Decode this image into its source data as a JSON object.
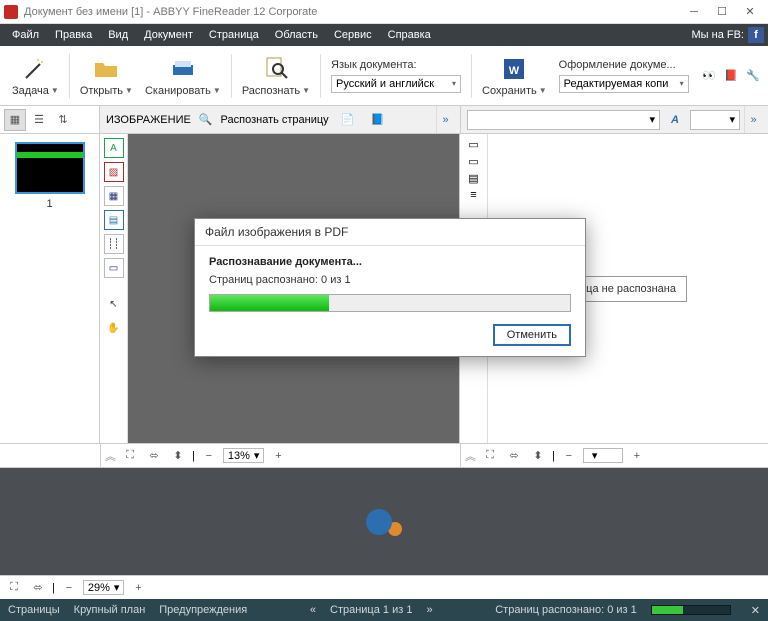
{
  "title": "Документ без имени [1] - ABBYY FineReader 12 Corporate",
  "menu": [
    "Файл",
    "Правка",
    "Вид",
    "Документ",
    "Страница",
    "Область",
    "Сервис",
    "Справка"
  ],
  "menu_right": "Мы на FB:",
  "ribbon": {
    "task": "Задача",
    "open": "Открыть",
    "scan": "Сканировать",
    "read": "Распознать",
    "lang_label": "Язык документа:",
    "lang_value": "Русский и английск",
    "save": "Сохранить",
    "format_label": "Оформление докуме...",
    "format_value": "Редактируемая копи"
  },
  "secbar": {
    "image_label": "ИЗОБРАЖЕНИЕ",
    "read_page": "Распознать страницу"
  },
  "thumb": {
    "page_number": "1"
  },
  "textview_msg": "ица не распознана",
  "zoom": {
    "img": "13%",
    "bottom": "29%"
  },
  "status": {
    "tabs": [
      "Страницы",
      "Крупный план",
      "Предупреждения"
    ],
    "page_info": "Страница 1 из 1",
    "recognized": "Страниц распознано: 0 из 1"
  },
  "dialog": {
    "title": "Файл изображения в PDF",
    "heading": "Распознавание документа...",
    "progress": "Страниц распознано: 0 из 1",
    "cancel": "Отменить"
  }
}
